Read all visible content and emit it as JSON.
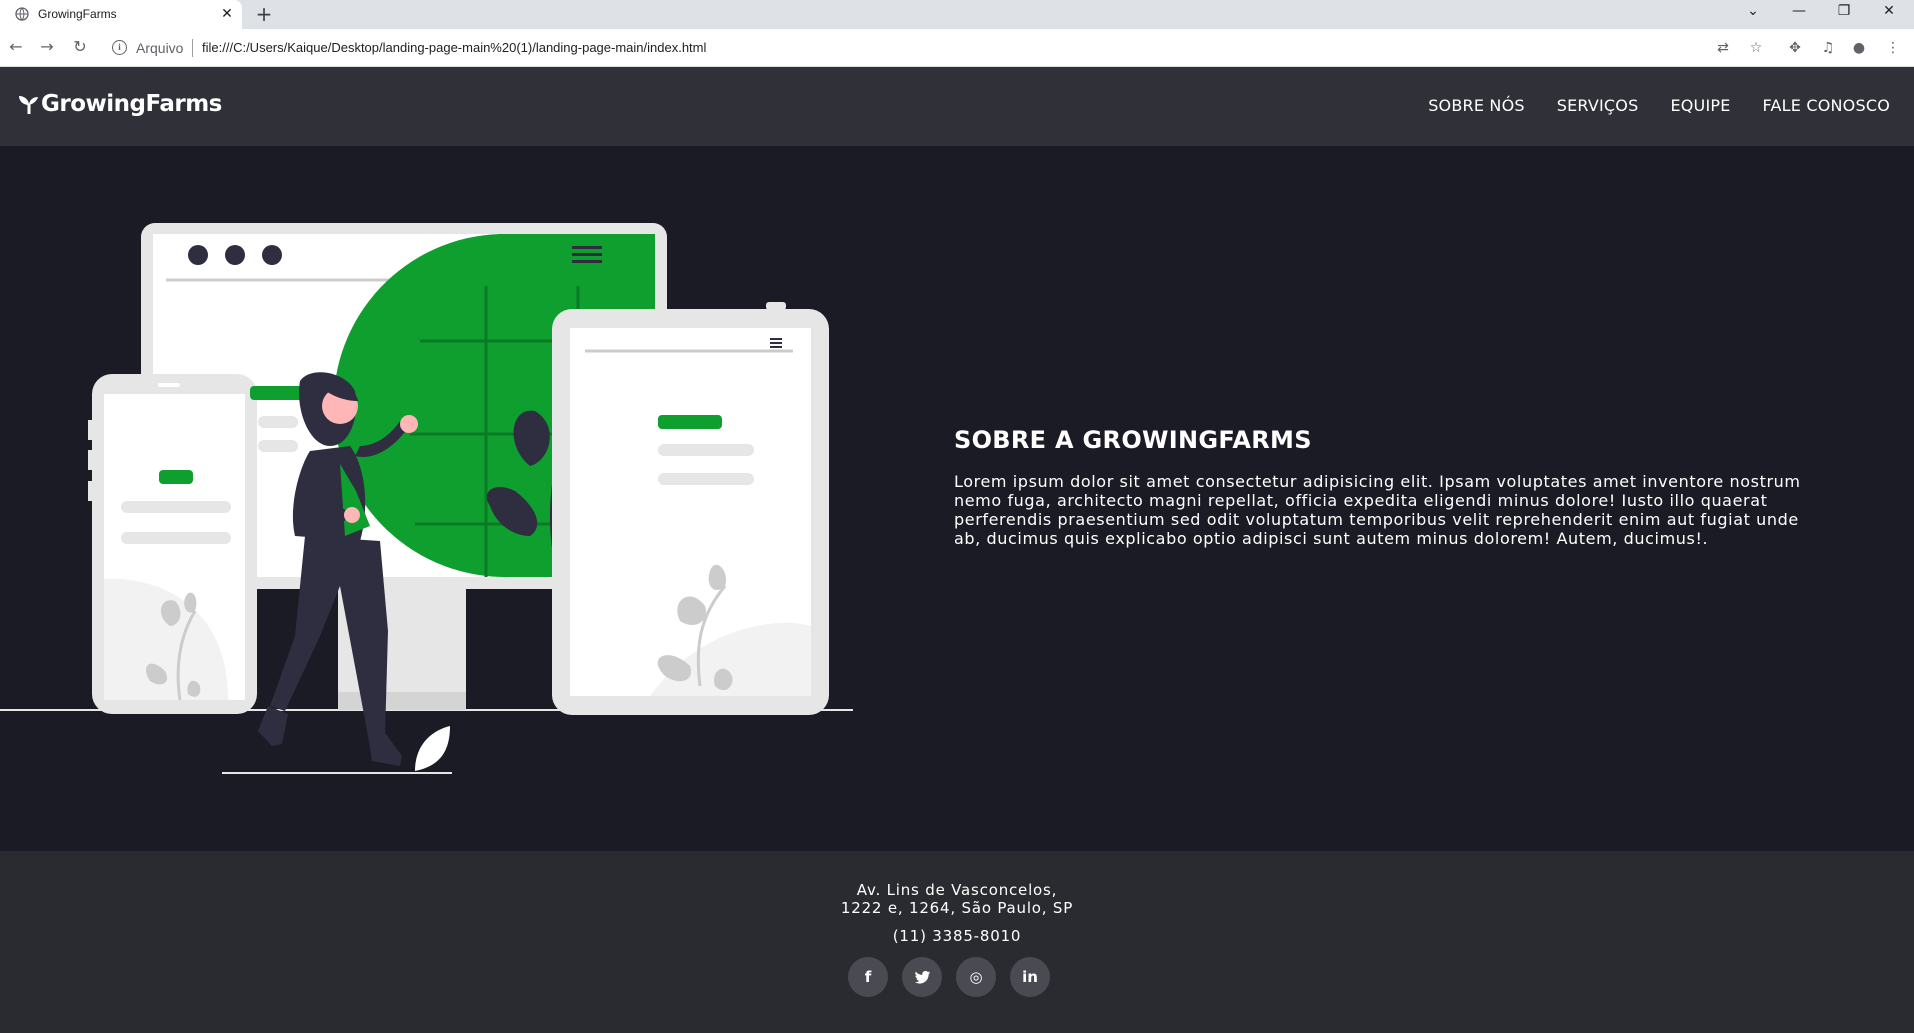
{
  "browser": {
    "tab_title": "GrowingFarms",
    "tab_close": "✕",
    "new_tab": "+",
    "address_label": "Arquivo",
    "url": "file:///C:/Users/Kaique/Desktop/landing-page-main%20(1)/landing-page-main/index.html",
    "icons": [
      "back-icon",
      "forward-icon",
      "reload-icon",
      "info-icon",
      "translate-icon",
      "star-icon",
      "extensions-icon",
      "media-icon",
      "profile-icon",
      "menu-icon",
      "minimize-icon",
      "restore-icon",
      "close-icon",
      "tab-search-icon"
    ]
  },
  "header": {
    "logo_text": "GrowingFarms",
    "nav": [
      "SOBRE NÓS",
      "SERVIÇOS",
      "EQUIPE",
      "FALE CONOSCO"
    ]
  },
  "about": {
    "title": "SOBRE A GROWINGFARMS",
    "text": "Lorem ipsum dolor sit amet consectetur adipisicing elit. Ipsam voluptates amet inventore nostrum nemo fuga, architecto magni repellat, officia expedita eligendi minus dolore! Iusto illo quaerat perferendis praesentium sed odit voluptatum temporibus velit reprehenderit enim aut fugiat unde ab, ducimus quis explicabo optio adipisci sunt autem minus dolorem! Autem, ducimus!."
  },
  "footer": {
    "address_line1": "Av. Lins de Vasconcelos,",
    "address_line2": "1222 e, 1264, São Paulo, SP",
    "phone": "(11) 3385-8010",
    "socials": {
      "facebook": "f",
      "twitter": "t",
      "instagram": "◎",
      "linkedin": "in"
    }
  },
  "colors": {
    "accent": "#0e9f2f",
    "header_bg": "#2f3038",
    "hero_bg": "#1b1b25",
    "footer_bg": "#2a2b30"
  }
}
